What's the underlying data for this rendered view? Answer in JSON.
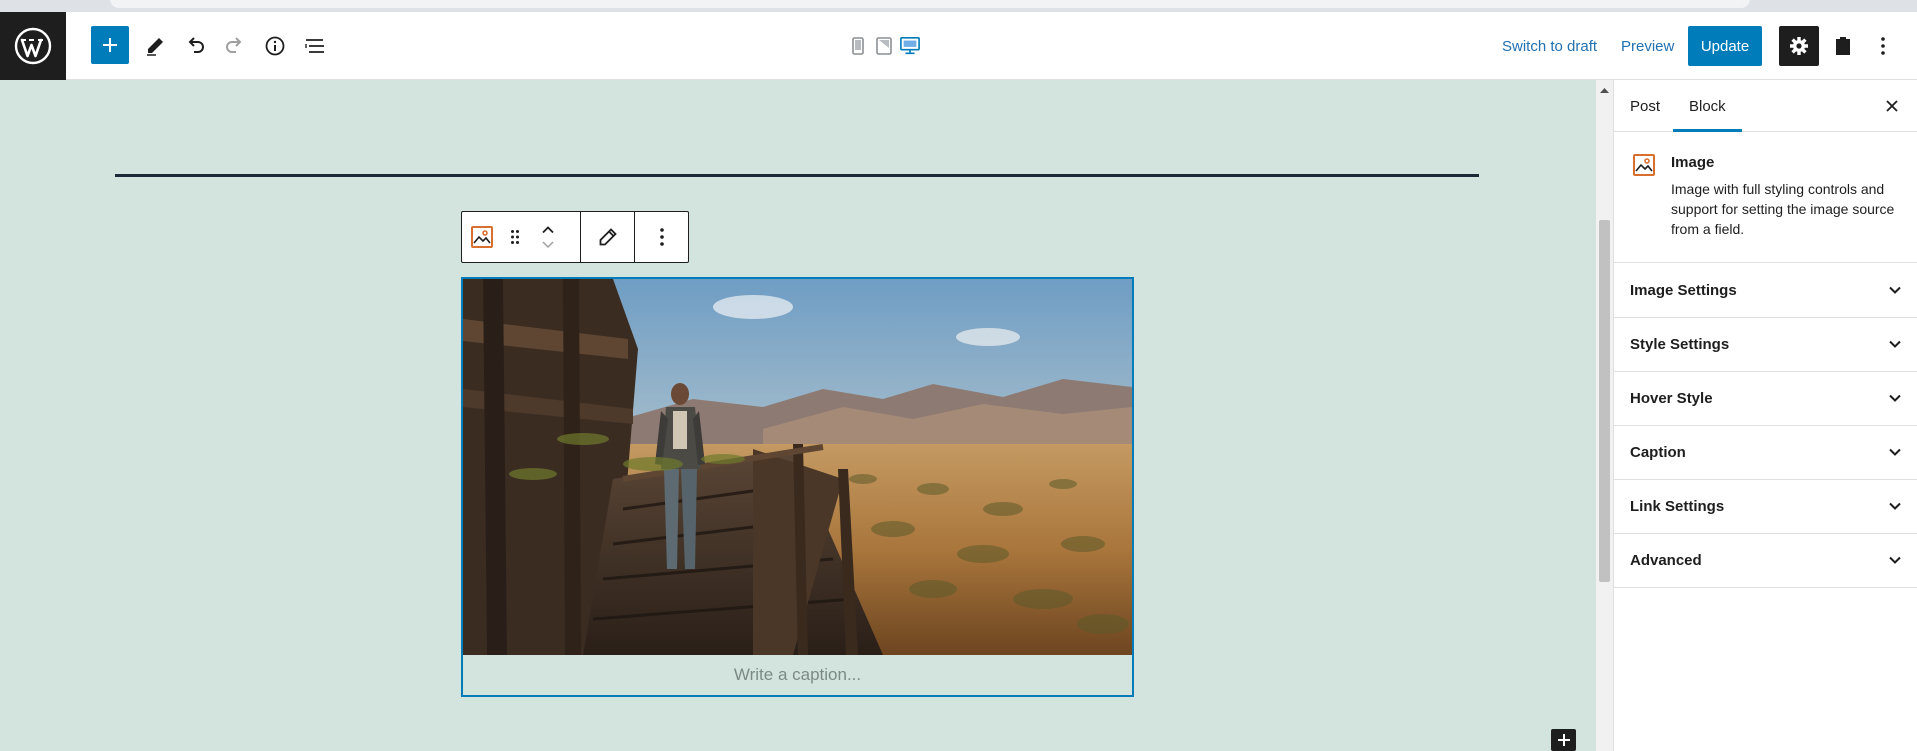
{
  "toolbar": {
    "add_block_icon": "plus-icon",
    "tools_icon": "pencil-icon",
    "undo_icon": "undo-icon",
    "redo_icon": "redo-icon",
    "details_icon": "info-icon",
    "list_view_icon": "list-view-icon",
    "preview_devices": [
      "mobile-icon",
      "tablet-icon",
      "desktop-icon"
    ],
    "active_device": "desktop",
    "switch_to_draft": "Switch to draft",
    "preview": "Preview",
    "update": "Update",
    "accent_color": "#007cba"
  },
  "canvas": {
    "background_color": "#d3e4de",
    "separator_color": "#1c2936",
    "image_block": {
      "caption_placeholder": "Write a caption...",
      "image_subject": "figure standing on wooden walkway overlooking desert valley"
    },
    "block_toolbar_icons": [
      "image-block-icon",
      "drag-handle-icon",
      "move-up-icon",
      "move-down-icon",
      "edit-pencil-icon",
      "more-options-icon"
    ]
  },
  "sidebar": {
    "tabs": [
      {
        "label": "Post",
        "active": false
      },
      {
        "label": "Block",
        "active": true
      }
    ],
    "block_card": {
      "title": "Image",
      "description": "Image with full styling controls and support for setting the image source from a field."
    },
    "panels": [
      {
        "label": "Image Settings"
      },
      {
        "label": "Style Settings"
      },
      {
        "label": "Hover Style"
      },
      {
        "label": "Caption"
      },
      {
        "label": "Link Settings"
      },
      {
        "label": "Advanced"
      }
    ]
  }
}
